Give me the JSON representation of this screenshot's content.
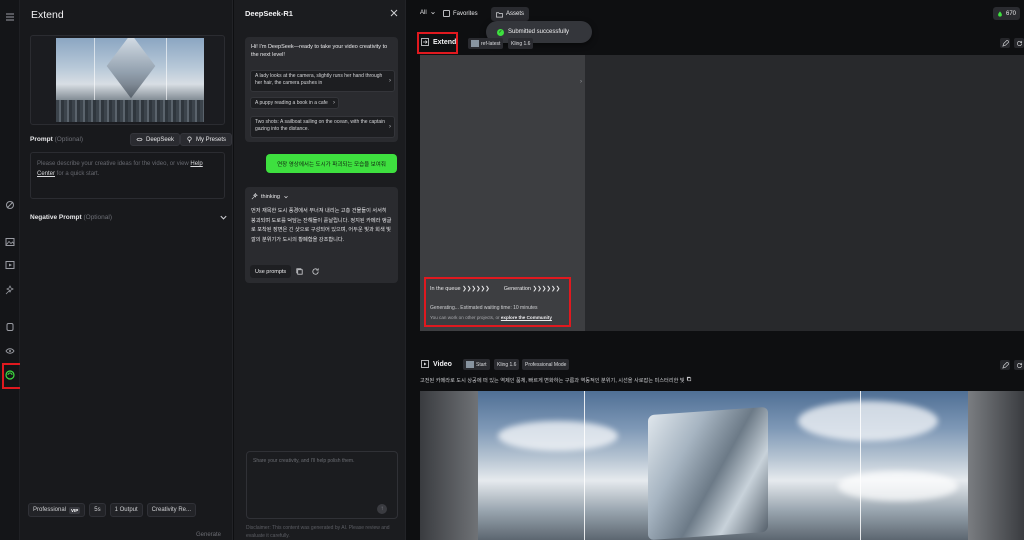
{
  "extend_panel": {
    "title": "Extend",
    "prompt_label": "Prompt",
    "prompt_optional": "(Optional)",
    "deepseek_btn": "DeepSeek",
    "my_presets_btn": "My Presets",
    "prompt_placeholder_pre": "Please describe your creative ideas for the video, or view ",
    "help_center": "Help Center",
    "prompt_placeholder_post": " for a quick start.",
    "negative_label": "Negative Prompt",
    "negative_optional": "(Optional)",
    "mode": "Professional",
    "vip": "VIP",
    "duration": "5s",
    "outputs": "1 Output",
    "creativity": "Creativity Re...",
    "generate": "Generate"
  },
  "deepseek_panel": {
    "title": "DeepSeek-R1",
    "intro": "Hi! I'm DeepSeek—ready to take your video creativity to the next level!",
    "suggestions": [
      "A lady looks at the camera, slightly runs her hand through her hair, the camera pushes in",
      "A puppy reading a book in a cafe",
      "Two shots: A sailboat sailing on the ocean, with the captain gazing into the distance."
    ],
    "user_msg": "연장 영상에서는 도시가 파괴되는 모습을 보여줘",
    "thinking_label": "thinking",
    "thinking_body": "먼저 재목한 도시 풍경에서 무너져 내리는 고층 건물들이 서서히 붕괴되며 도로를 덕담는 잔해들이 흩날립니다. 정지된 카메라 앵글로 포착된 장면은 긴 샷으로 구성되어 있으며, 어두운 빛과 회색 빛깔의 분위기가 도시의 황폐함을 강조합니다.",
    "use_prompts": "Use prompts",
    "polish_placeholder": "Share your creativity, and I'll help polish them.",
    "disclaimer": "Disclaimer: This content was generated by AI. Please review and evaluate it carefully."
  },
  "topbar": {
    "all": "All",
    "favorites": "Favorites",
    "assets": "Assets",
    "credits": "670"
  },
  "toast": {
    "text": "Submitted successfully"
  },
  "extend_section": {
    "title": "Extend",
    "tag1": "ref-latest",
    "tag2": "Kling 1.6",
    "queue_label": "In the queue",
    "arrows": "❯❯❯❯❯❯",
    "generation_label": "Generation",
    "generating": "Generating... Estimated waiting time: 10 minutes",
    "work_note_pre": "You can work on other projects, or ",
    "explore": "explore the Community"
  },
  "video_section": {
    "title": "Video",
    "start": "Start",
    "model": "Kling 1.6",
    "mode": "Professional Mode",
    "description": "고전된 카메라로 도시 상공에 떠 있는 역제인 품체, 빠르게 변화하는 구름과 역동적인 분위기, 시선을 사로잡는 미스터리한 빛"
  }
}
